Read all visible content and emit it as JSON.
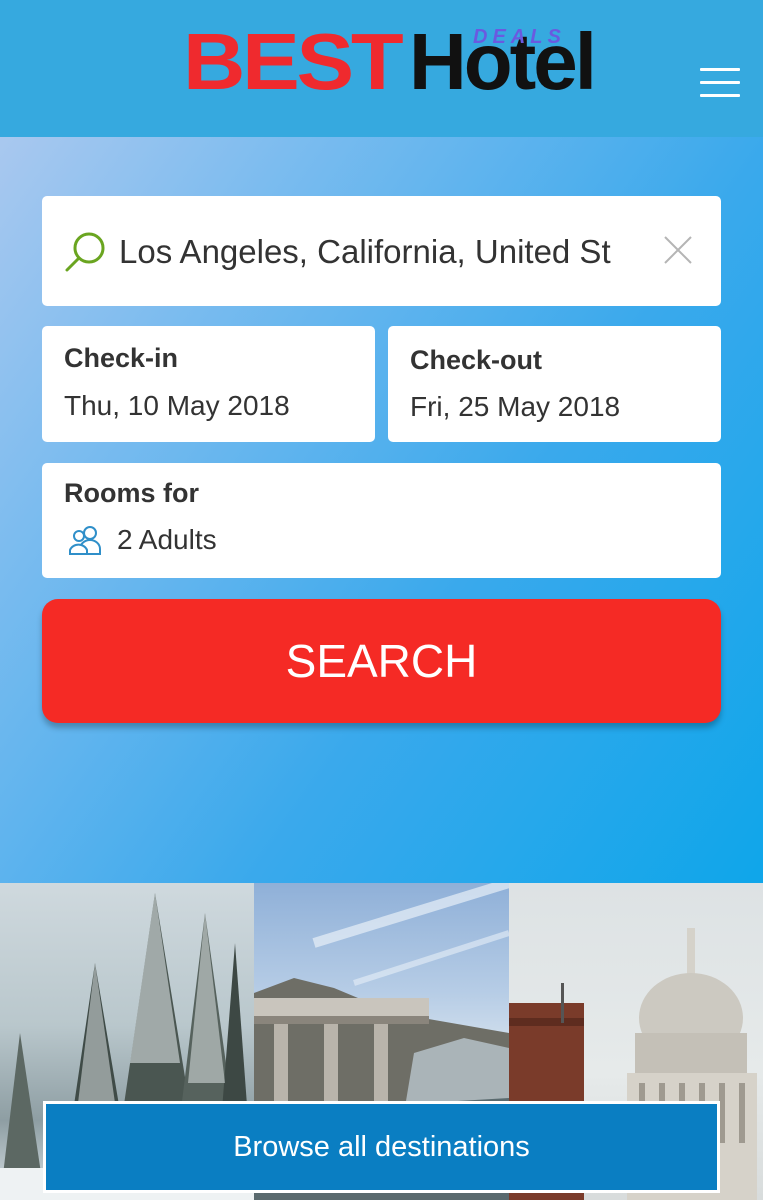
{
  "header": {
    "logo": {
      "best": "BEST",
      "hotel": "Hotel",
      "deals": "DEALS"
    },
    "menu_icon": "hamburger-menu-icon"
  },
  "search": {
    "icon": "search-icon",
    "value": "Los Angeles, California, United St",
    "clear_icon": "close-icon"
  },
  "checkin": {
    "label": "Check-in",
    "value": "Thu, 10 May 2018"
  },
  "checkout": {
    "label": "Check-out",
    "value": "Fri, 25 May 2018"
  },
  "rooms": {
    "label": "Rooms for",
    "icon": "people-icon",
    "value": "2 Adults"
  },
  "search_button": {
    "label": "SEARCH"
  },
  "browse_button": {
    "label": "Browse all destinations"
  },
  "colors": {
    "header_bg": "#36a9df",
    "logo_red": "#ef2a2e",
    "search_button": "#f52a25",
    "browse_button": "#0a7ec2",
    "search_icon": "#6aa520"
  },
  "images": [
    "snowy-forest-photo",
    "coastal-bridge-photo",
    "domed-cathedral-photo"
  ]
}
